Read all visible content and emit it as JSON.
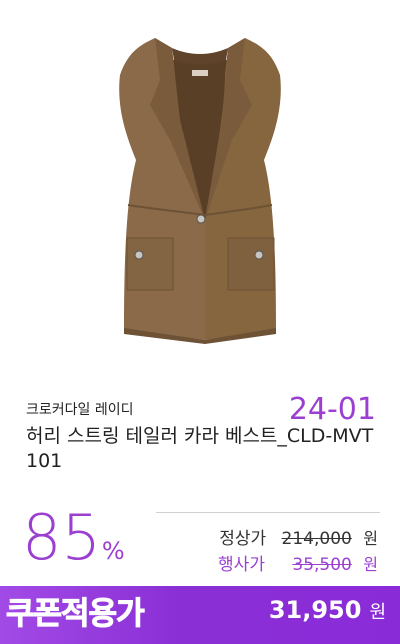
{
  "product": {
    "image_alt": "vest-image",
    "code": "24-01",
    "brand": "크로커다일 레이디",
    "title": "허리 스트링 테일러 카라 베스트_CLD-MVT101"
  },
  "pricing": {
    "discount_value": "85",
    "discount_unit": "%",
    "regular_label": "정상가",
    "regular_price": "214,000",
    "event_label": "행사가",
    "event_price": "35,500",
    "currency": "원"
  },
  "banner": {
    "label": "쿠폰적용가",
    "price": "31,950",
    "currency": "원"
  },
  "colors": {
    "accent": "#9b3fd1",
    "banner": "#8a2fd6",
    "vest": "#8a6a48"
  }
}
